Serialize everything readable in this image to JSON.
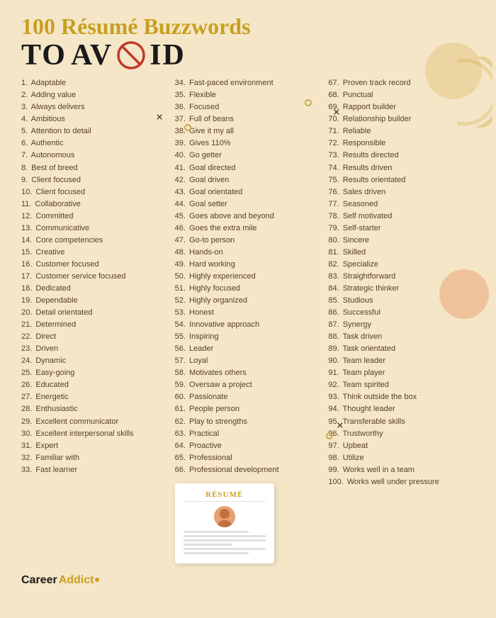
{
  "title": "100 Résumé Buzzwords",
  "subtitle": "TO AVOID",
  "logo": {
    "career": "Career",
    "addict": "Addict"
  },
  "resume_card_title": "RÉSUMÉ",
  "column1": [
    {
      "num": 1,
      "text": "Adaptable"
    },
    {
      "num": 2,
      "text": "Adding value"
    },
    {
      "num": 3,
      "text": "Always delivers"
    },
    {
      "num": 4,
      "text": "Ambitious"
    },
    {
      "num": 5,
      "text": "Attention to detail"
    },
    {
      "num": 6,
      "text": "Authentic"
    },
    {
      "num": 7,
      "text": "Autonomous"
    },
    {
      "num": 8,
      "text": "Best of breed"
    },
    {
      "num": 9,
      "text": "Client focused"
    },
    {
      "num": 10,
      "text": "Client focused"
    },
    {
      "num": 11,
      "text": "Collaborative"
    },
    {
      "num": 12,
      "text": "Committed"
    },
    {
      "num": 13,
      "text": "Communicative"
    },
    {
      "num": 14,
      "text": "Core competencies"
    },
    {
      "num": 15,
      "text": "Creative"
    },
    {
      "num": 16,
      "text": "Customer focused"
    },
    {
      "num": 17,
      "text": "Customer service focused"
    },
    {
      "num": 18,
      "text": "Dedicated"
    },
    {
      "num": 19,
      "text": "Dependable"
    },
    {
      "num": 20,
      "text": "Detail orientated"
    },
    {
      "num": 21,
      "text": "Determined"
    },
    {
      "num": 22,
      "text": "Direct"
    },
    {
      "num": 23,
      "text": "Driven"
    },
    {
      "num": 24,
      "text": "Dynamic"
    },
    {
      "num": 25,
      "text": "Easy-going"
    },
    {
      "num": 26,
      "text": "Educated"
    },
    {
      "num": 27,
      "text": "Energetic"
    },
    {
      "num": 28,
      "text": "Enthusiastic"
    },
    {
      "num": 29,
      "text": "Excellent communicator"
    },
    {
      "num": 30,
      "text": "Excellent interpersonal skills"
    },
    {
      "num": 31,
      "text": "Expert"
    },
    {
      "num": 32,
      "text": "Familiar with"
    },
    {
      "num": 33,
      "text": "Fast learner"
    }
  ],
  "column2": [
    {
      "num": 34,
      "text": "Fast-paced environment"
    },
    {
      "num": 35,
      "text": "Flexible"
    },
    {
      "num": 36,
      "text": "Focused"
    },
    {
      "num": 37,
      "text": "Full of beans"
    },
    {
      "num": 38,
      "text": "Give it my all"
    },
    {
      "num": 39,
      "text": "Gives 110%"
    },
    {
      "num": 40,
      "text": "Go getter"
    },
    {
      "num": 41,
      "text": "Goal directed"
    },
    {
      "num": 42,
      "text": "Goal driven"
    },
    {
      "num": 43,
      "text": "Goal orientated"
    },
    {
      "num": 44,
      "text": "Goal setter"
    },
    {
      "num": 45,
      "text": "Goes above and beyond"
    },
    {
      "num": 46,
      "text": "Goes the extra mile"
    },
    {
      "num": 47,
      "text": "Go-to person"
    },
    {
      "num": 48,
      "text": "Hands-on"
    },
    {
      "num": 49,
      "text": "Hard working"
    },
    {
      "num": 50,
      "text": "Highly experienced"
    },
    {
      "num": 51,
      "text": "Highly focused"
    },
    {
      "num": 52,
      "text": "Highly organized"
    },
    {
      "num": 53,
      "text": "Honest"
    },
    {
      "num": 54,
      "text": "Innovative approach"
    },
    {
      "num": 55,
      "text": "Inspiring"
    },
    {
      "num": 56,
      "text": "Leader"
    },
    {
      "num": 57,
      "text": "Loyal"
    },
    {
      "num": 58,
      "text": "Motivates others"
    },
    {
      "num": 59,
      "text": "Oversaw a project"
    },
    {
      "num": 60,
      "text": "Passionate"
    },
    {
      "num": 61,
      "text": "People person"
    },
    {
      "num": 62,
      "text": "Play to strengths"
    },
    {
      "num": 63,
      "text": "Practical"
    },
    {
      "num": 64,
      "text": "Proactive"
    },
    {
      "num": 65,
      "text": "Professional"
    },
    {
      "num": 66,
      "text": "Professional development"
    }
  ],
  "column3": [
    {
      "num": 67,
      "text": "Proven track record"
    },
    {
      "num": 68,
      "text": "Punctual"
    },
    {
      "num": 69,
      "text": "Rapport builder"
    },
    {
      "num": 70,
      "text": "Relationship builder"
    },
    {
      "num": 71,
      "text": "Reliable"
    },
    {
      "num": 72,
      "text": "Responsible"
    },
    {
      "num": 73,
      "text": "Results directed"
    },
    {
      "num": 74,
      "text": "Results driven"
    },
    {
      "num": 75,
      "text": "Results orientated"
    },
    {
      "num": 76,
      "text": "Sales driven"
    },
    {
      "num": 77,
      "text": "Seasoned"
    },
    {
      "num": 78,
      "text": "Self motivated"
    },
    {
      "num": 79,
      "text": "Self-starter"
    },
    {
      "num": 80,
      "text": "Sincere"
    },
    {
      "num": 81,
      "text": "Skilled"
    },
    {
      "num": 82,
      "text": "Specialize"
    },
    {
      "num": 83,
      "text": "Straightforward"
    },
    {
      "num": 84,
      "text": "Strategic thinker"
    },
    {
      "num": 85,
      "text": "Studious"
    },
    {
      "num": 86,
      "text": "Successful"
    },
    {
      "num": 87,
      "text": "Synergy"
    },
    {
      "num": 88,
      "text": "Task driven"
    },
    {
      "num": 89,
      "text": "Task orientated"
    },
    {
      "num": 90,
      "text": "Team leader"
    },
    {
      "num": 91,
      "text": "Team player"
    },
    {
      "num": 92,
      "text": "Team spirited"
    },
    {
      "num": 93,
      "text": "Think outside the box"
    },
    {
      "num": 94,
      "text": "Thought leader"
    },
    {
      "num": 95,
      "text": "Transferable skills"
    },
    {
      "num": 96,
      "text": "Trustworthy"
    },
    {
      "num": 97,
      "text": "Upbeat"
    },
    {
      "num": 98,
      "text": "Utilize"
    },
    {
      "num": 99,
      "text": "Works well in a team"
    },
    {
      "num": 100,
      "text": "Works well under pressure"
    }
  ]
}
